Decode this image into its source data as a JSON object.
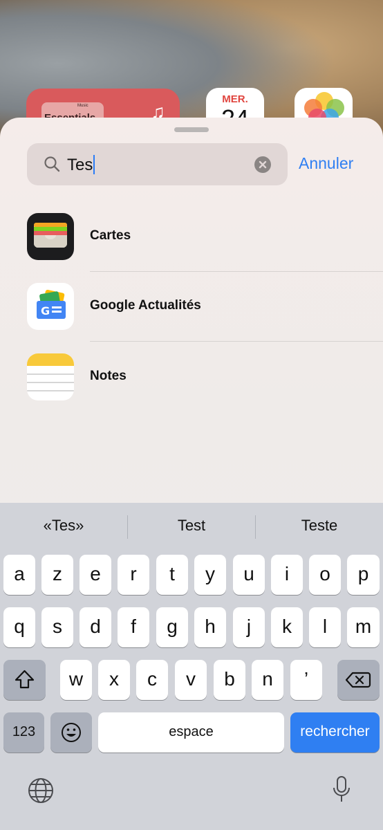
{
  "background": {
    "widget_title": "Essentials",
    "widget_brand": "Music",
    "calendar_day": "MER.",
    "calendar_date": "24"
  },
  "search": {
    "query": "Tes",
    "cancel_label": "Annuler"
  },
  "results": [
    {
      "label": "Cartes",
      "icon": "wallet-app-icon"
    },
    {
      "label": "Google Actualités",
      "icon": "google-news-app-icon"
    },
    {
      "label": "Notes",
      "icon": "notes-app-icon"
    }
  ],
  "keyboard": {
    "suggestions": [
      "«Tes»",
      "Test",
      "Teste"
    ],
    "row1": [
      "a",
      "z",
      "e",
      "r",
      "t",
      "y",
      "u",
      "i",
      "o",
      "p"
    ],
    "row2": [
      "q",
      "s",
      "d",
      "f",
      "g",
      "h",
      "j",
      "k",
      "l",
      "m"
    ],
    "row3": [
      "w",
      "x",
      "c",
      "v",
      "b",
      "n",
      "’"
    ],
    "numbers_label": "123",
    "space_label": "espace",
    "search_label": "rechercher"
  },
  "colors": {
    "accent": "#2f7ff2",
    "keyboard_bg": "#d1d3d9"
  }
}
